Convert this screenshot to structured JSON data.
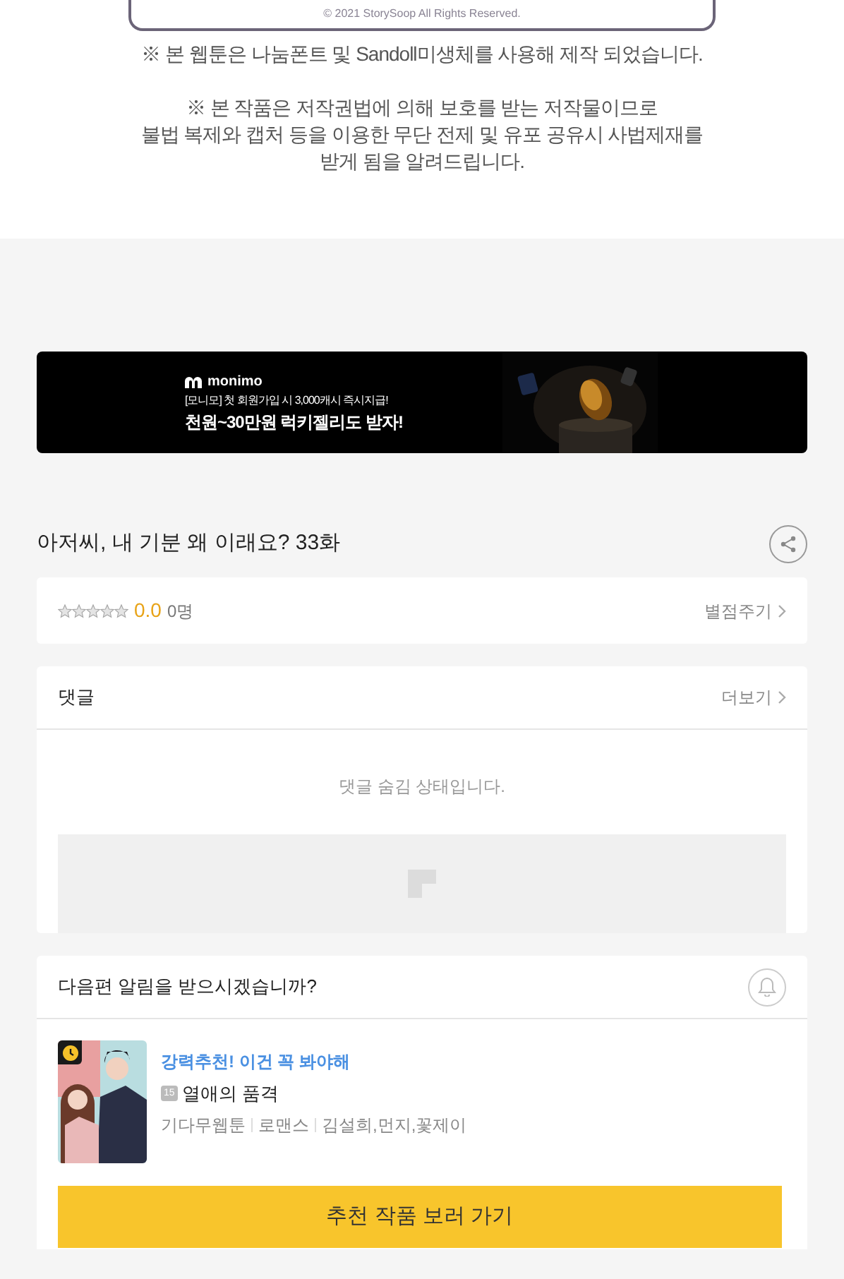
{
  "comic_footer": {
    "copyright": "© 2021 StorySoop All Rights Reserved.",
    "font_notice": "※ 본 웹툰은 나눔폰트 및 Sandoll미생체를 사용해 제작 되었습니다.",
    "copyright_notice": [
      "※ 본 작품은 저작권법에 의해 보호를 받는 저작물이므로",
      "불법 복제와 캡처 등을 이용한 무단 전제 및 유포 공유시 사법제재를",
      "받게 됨을 알려드립니다."
    ]
  },
  "banner": {
    "brand": "monimo",
    "subtitle": "[모니모] 첫 회원가입 시 3,000캐시 즉시지급!",
    "headline": "천원~30만원 럭키젤리도 받자!"
  },
  "episode_title": "아저씨, 내 기분 왜 이래요? 33화",
  "rating": {
    "stars": 0,
    "score": "0.0",
    "count": "0명",
    "action": "별점주기"
  },
  "comments": {
    "title": "댓글",
    "more": "더보기",
    "hidden_message": "댓글 숨김 상태입니다."
  },
  "notify": {
    "question": "다음편 알림을 받으시겠습니까?",
    "on": false
  },
  "recommendation": {
    "tagline": "강력추천! 이건 꼭 봐야해",
    "age": "15",
    "title": "열애의 품격",
    "meta": [
      "기다무웹툰",
      "로맨스",
      "김설희,먼지,꽃제이"
    ],
    "button": "추천 작품 보러 가기"
  }
}
